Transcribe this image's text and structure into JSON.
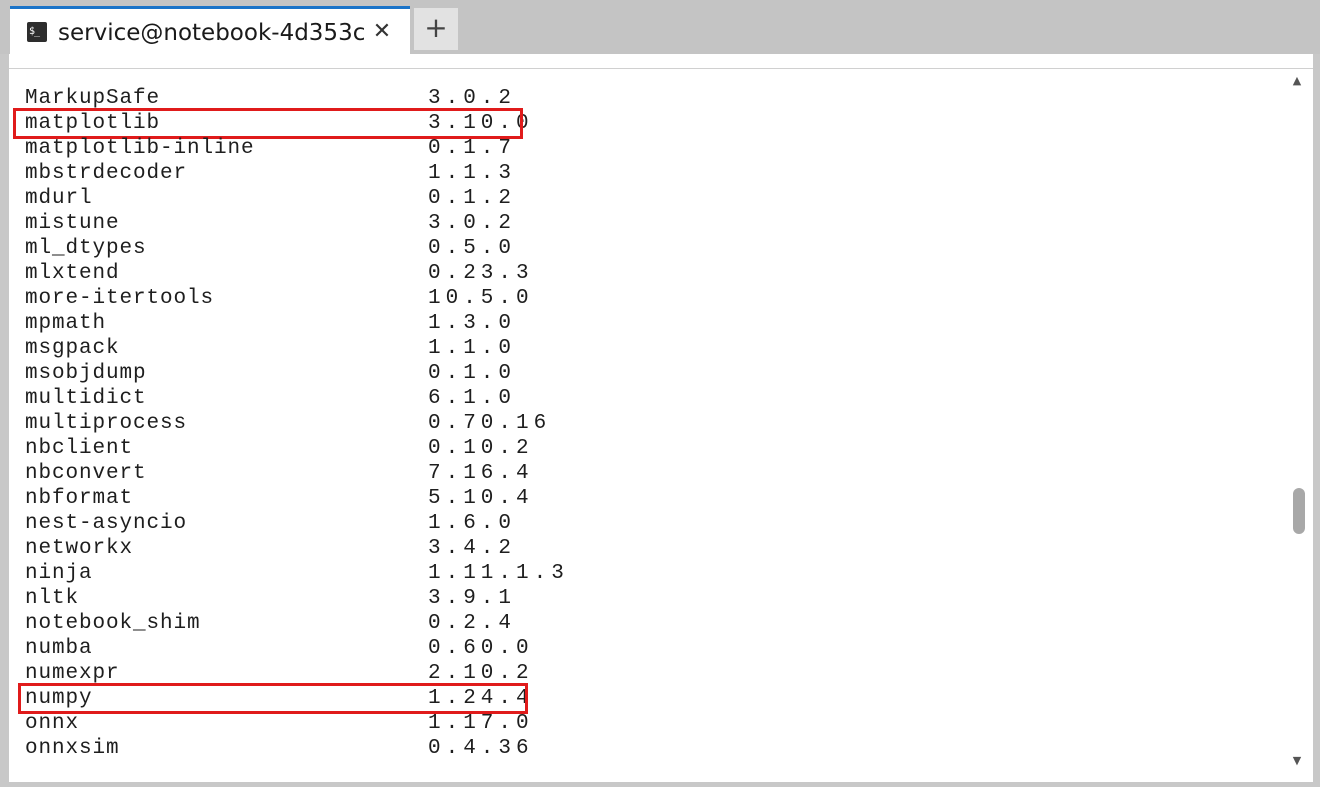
{
  "tab": {
    "icon": "terminal-icon",
    "icon_glyph": "$_",
    "title": "service@notebook-4d353c",
    "close_glyph": "✕"
  },
  "new_tab": {
    "glyph": "+"
  },
  "packages": [
    {
      "name": "MarkupSafe",
      "version": "3.0.2"
    },
    {
      "name": "matplotlib",
      "version": "3.10.0"
    },
    {
      "name": "matplotlib-inline",
      "version": "0.1.7"
    },
    {
      "name": "mbstrdecoder",
      "version": "1.1.3"
    },
    {
      "name": "mdurl",
      "version": "0.1.2"
    },
    {
      "name": "mistune",
      "version": "3.0.2"
    },
    {
      "name": "ml_dtypes",
      "version": "0.5.0"
    },
    {
      "name": "mlxtend",
      "version": "0.23.3"
    },
    {
      "name": "more-itertools",
      "version": "10.5.0"
    },
    {
      "name": "mpmath",
      "version": "1.3.0"
    },
    {
      "name": "msgpack",
      "version": "1.1.0"
    },
    {
      "name": "msobjdump",
      "version": "0.1.0"
    },
    {
      "name": "multidict",
      "version": "6.1.0"
    },
    {
      "name": "multiprocess",
      "version": "0.70.16"
    },
    {
      "name": "nbclient",
      "version": "0.10.2"
    },
    {
      "name": "nbconvert",
      "version": "7.16.4"
    },
    {
      "name": "nbformat",
      "version": "5.10.4"
    },
    {
      "name": "nest-asyncio",
      "version": "1.6.0"
    },
    {
      "name": "networkx",
      "version": "3.4.2"
    },
    {
      "name": "ninja",
      "version": "1.11.1.3"
    },
    {
      "name": "nltk",
      "version": "3.9.1"
    },
    {
      "name": "notebook_shim",
      "version": "0.2.4"
    },
    {
      "name": "numba",
      "version": "0.60.0"
    },
    {
      "name": "numexpr",
      "version": "2.10.2"
    },
    {
      "name": "numpy",
      "version": "1.24.4"
    },
    {
      "name": "onnx",
      "version": "1.17.0"
    },
    {
      "name": "onnxsim",
      "version": "0.4.36"
    }
  ],
  "highlighted_packages": [
    "matplotlib",
    "numpy"
  ],
  "colors": {
    "highlight": "#e01b1b",
    "tab_accent": "#1a73c8",
    "text": "#1e1e1e"
  },
  "scrollbar": {
    "up_glyph": "▲",
    "down_glyph": "▼"
  }
}
